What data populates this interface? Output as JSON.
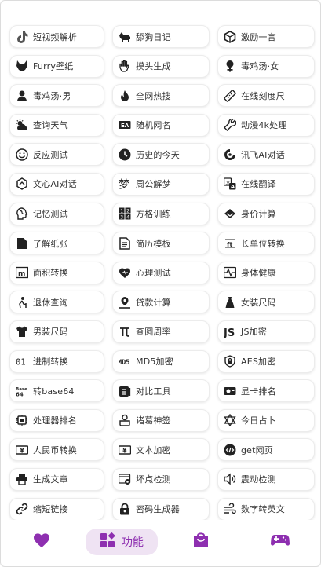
{
  "accent": "#8e2fb0",
  "tools": [
    {
      "label": "短视频解析",
      "icon": "tiktok-icon",
      "name": "tool-video-parse"
    },
    {
      "label": "舔狗日记",
      "icon": "dog-icon",
      "name": "tool-dog-diary"
    },
    {
      "label": "激励一言",
      "icon": "cube-icon",
      "name": "tool-motivation"
    },
    {
      "label": "Furry壁纸",
      "icon": "fox-icon",
      "name": "tool-furry-wallpaper"
    },
    {
      "label": "摸头生成",
      "icon": "hand-icon",
      "name": "tool-pat-head"
    },
    {
      "label": "毒鸡汤·女",
      "icon": "female-icon",
      "name": "tool-soup-female"
    },
    {
      "label": "毒鸡汤·男",
      "icon": "person-icon",
      "name": "tool-soup-male"
    },
    {
      "label": "全网热搜",
      "icon": "flame-icon",
      "name": "tool-hot-search"
    },
    {
      "label": "在线刻度尺",
      "icon": "ruler-icon",
      "name": "tool-ruler"
    },
    {
      "label": "查询天气",
      "icon": "weather-icon",
      "name": "tool-weather"
    },
    {
      "label": "随机网名",
      "icon": "name-tag-icon",
      "name": "tool-random-name"
    },
    {
      "label": "动漫4k处理",
      "icon": "wrench-icon",
      "name": "tool-anime-4k"
    },
    {
      "label": "反应测试",
      "icon": "smile-icon",
      "name": "tool-reaction-test"
    },
    {
      "label": "历史的今天",
      "icon": "clock-icon",
      "name": "tool-history-today"
    },
    {
      "label": "讯飞AI对话",
      "icon": "robot-icon",
      "name": "tool-xunfei-ai"
    },
    {
      "label": "文心AI对话",
      "icon": "hexagon-icon",
      "name": "tool-wenxin-ai"
    },
    {
      "label": "周公解梦",
      "icon": "dream-icon",
      "name": "tool-dream"
    },
    {
      "label": "在线翻译",
      "icon": "translate-icon",
      "name": "tool-translate"
    },
    {
      "label": "记忆测试",
      "icon": "brain-icon",
      "name": "tool-memory-test"
    },
    {
      "label": "方格训练",
      "icon": "number-grid-icon",
      "name": "tool-grid-training"
    },
    {
      "label": "身价计算",
      "icon": "diamond-icon",
      "name": "tool-worth"
    },
    {
      "label": "了解纸张",
      "icon": "paper-icon",
      "name": "tool-paper"
    },
    {
      "label": "简历模板",
      "icon": "document-icon",
      "name": "tool-resume"
    },
    {
      "label": "长单位转换",
      "icon": "length-icon",
      "name": "tool-length-convert"
    },
    {
      "label": "面积转换",
      "icon": "area-icon",
      "name": "tool-area-convert"
    },
    {
      "label": "心理测试",
      "icon": "heart-icon",
      "name": "tool-psych-test"
    },
    {
      "label": "身体健康",
      "icon": "pulse-icon",
      "name": "tool-health"
    },
    {
      "label": "退休查询",
      "icon": "elder-icon",
      "name": "tool-retirement"
    },
    {
      "label": "贷款计算",
      "icon": "loan-icon",
      "name": "tool-loan"
    },
    {
      "label": "女装尺码",
      "icon": "dress-icon",
      "name": "tool-women-size"
    },
    {
      "label": "男装尺码",
      "icon": "shirt-icon",
      "name": "tool-men-size"
    },
    {
      "label": "查圆周率",
      "icon": "pi-icon",
      "name": "tool-pi"
    },
    {
      "label": "JS加密",
      "icon": "js-icon",
      "name": "tool-js-encrypt"
    },
    {
      "label": "进制转换",
      "icon": "binary-icon",
      "name": "tool-base-convert"
    },
    {
      "label": "MD5加密",
      "icon": "md5-icon",
      "name": "tool-md5"
    },
    {
      "label": "AES加密",
      "icon": "lock-shield-icon",
      "name": "tool-aes"
    },
    {
      "label": "转base64",
      "icon": "base64-icon",
      "name": "tool-base64"
    },
    {
      "label": "对比工具",
      "icon": "compare-icon",
      "name": "tool-compare"
    },
    {
      "label": "显卡排名",
      "icon": "gpu-icon",
      "name": "tool-gpu-rank"
    },
    {
      "label": "处理器排名",
      "icon": "cpu-icon",
      "name": "tool-cpu-rank"
    },
    {
      "label": "诸葛神签",
      "icon": "lot-icon",
      "name": "tool-zhuge"
    },
    {
      "label": "今日占卜",
      "icon": "star-icon",
      "name": "tool-divination"
    },
    {
      "label": "人民币转换",
      "icon": "banknote-icon",
      "name": "tool-rmb"
    },
    {
      "label": "文本加密",
      "icon": "cipher-icon",
      "name": "tool-text-encrypt"
    },
    {
      "label": "get网页",
      "icon": "code-icon",
      "name": "tool-get-web"
    },
    {
      "label": "生成文章",
      "icon": "printer-icon",
      "name": "tool-article"
    },
    {
      "label": "坏点检测",
      "icon": "pixel-check-icon",
      "name": "tool-dead-pixel"
    },
    {
      "label": "震动检测",
      "icon": "speaker-icon",
      "name": "tool-vibration"
    },
    {
      "label": "缩短链接",
      "icon": "link-icon",
      "name": "tool-short-link"
    },
    {
      "label": "密码生成器",
      "icon": "padlock-icon",
      "name": "tool-password"
    },
    {
      "label": "数字转英文",
      "icon": "wind-icon",
      "name": "tool-num-english"
    }
  ],
  "nav": {
    "favorites_icon": "heart-icon",
    "features_icon": "widgets-icon",
    "features_label": "功能",
    "shop_icon": "bag-icon",
    "game_icon": "gamepad-icon"
  }
}
